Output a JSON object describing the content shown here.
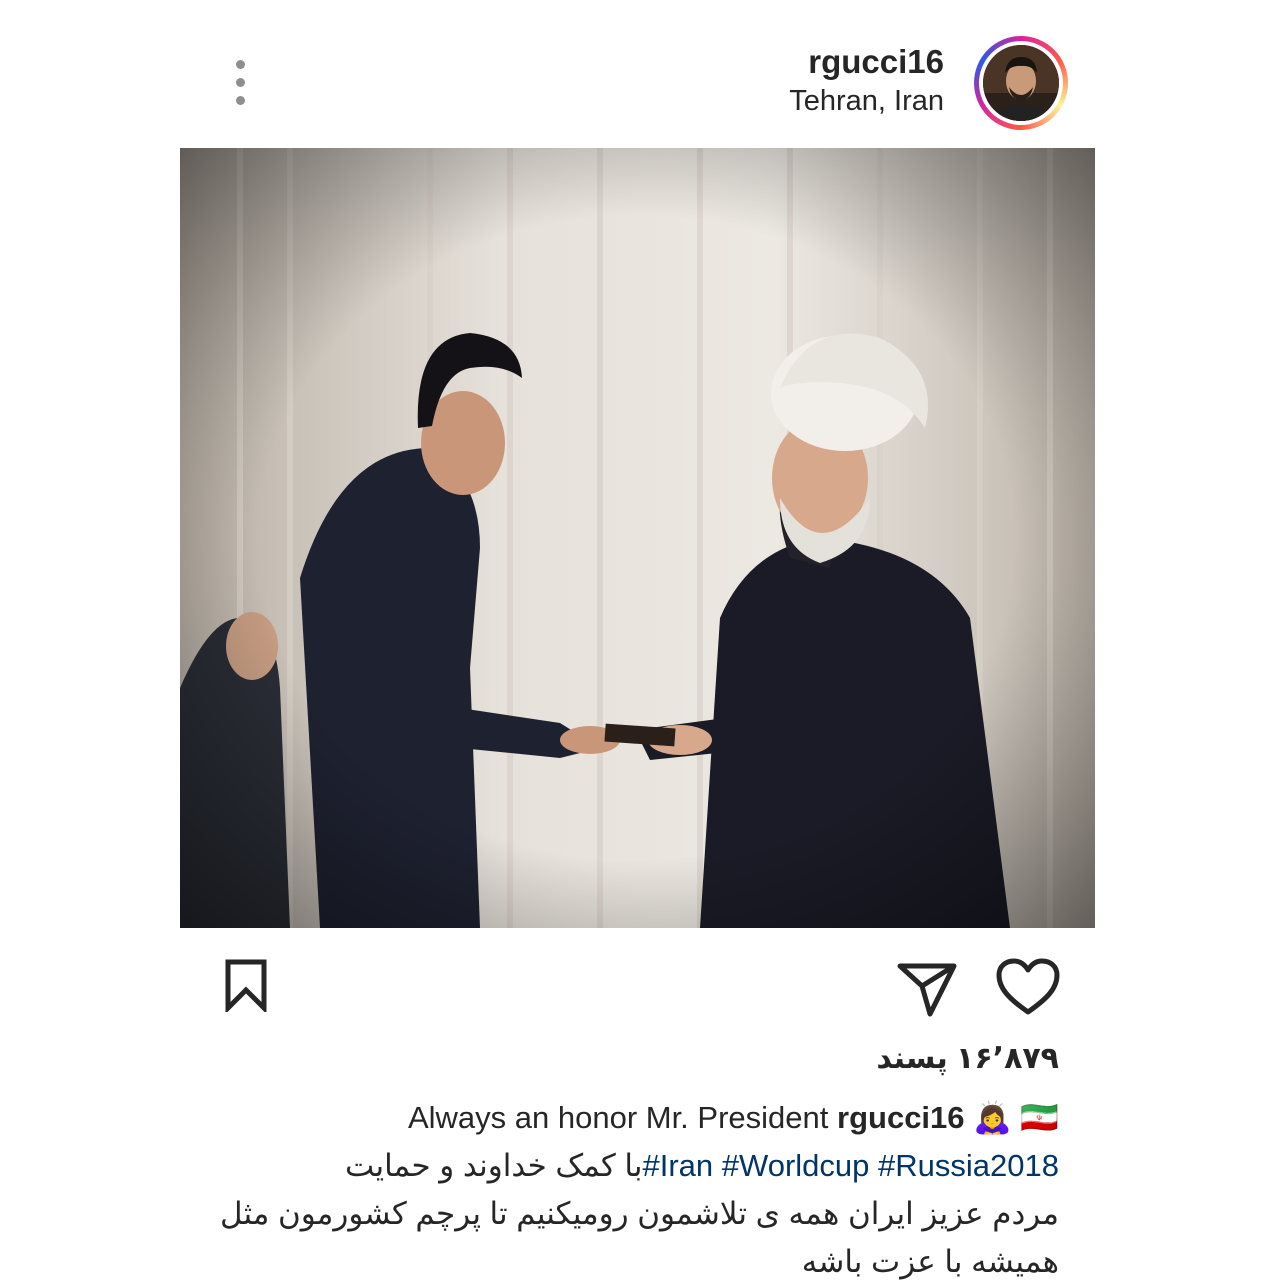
{
  "post": {
    "username": "rgucci16",
    "location": "Tehran, Iran",
    "likes_text": "۱۶٬۸۷۹ پسند",
    "caption": {
      "user": "rgucci16",
      "emoji_woman": "🙇‍♀️",
      "flag": "🇮🇷",
      "english": "Always an honor Mr. President",
      "tag_russia": "#Russia2018",
      "tag_worldcup": "#Worldcup",
      "tag_iran": "#Iran",
      "persian_1": "با کمک خداوند و حمایت",
      "persian_2": "مردم عزیز ایران همه ی تلاشمون رومیکنیم تا پرچم کشورمون مثل",
      "persian_3": "همیشه با عزت باشه"
    }
  },
  "icons": {
    "more": "more-vertical-icon",
    "bookmark": "bookmark-icon",
    "share": "send-icon",
    "like": "heart-icon"
  },
  "colors": {
    "text": "#262626",
    "hashtag": "#003569",
    "muted": "#8e8e8e"
  }
}
